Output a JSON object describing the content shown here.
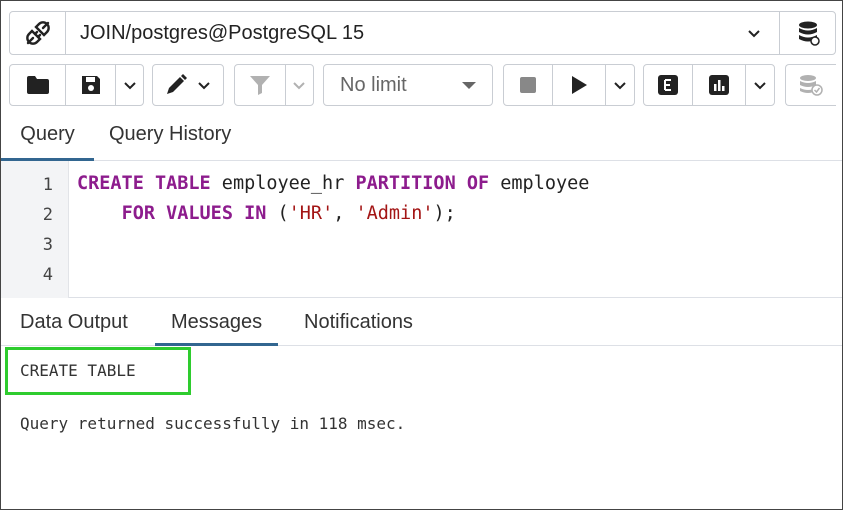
{
  "connection": {
    "title": "JOIN/postgres@PostgreSQL 15"
  },
  "toolbar": {
    "limit_label": "No limit"
  },
  "query_tabs": [
    {
      "label": "Query",
      "active": true
    },
    {
      "label": "Query History",
      "active": false
    }
  ],
  "editor": {
    "line_numbers": [
      "1",
      "2",
      "3",
      "4"
    ],
    "lines": [
      {
        "tokens": [
          {
            "text": "CREATE",
            "type": "keyword"
          },
          {
            "text": " ",
            "type": "plain"
          },
          {
            "text": "TABLE",
            "type": "keyword"
          },
          {
            "text": " employee_hr ",
            "type": "plain"
          },
          {
            "text": "PARTITION",
            "type": "keyword"
          },
          {
            "text": " ",
            "type": "plain"
          },
          {
            "text": "OF",
            "type": "keyword"
          },
          {
            "text": " employee",
            "type": "plain"
          }
        ]
      },
      {
        "tokens": [
          {
            "text": "    ",
            "type": "plain"
          },
          {
            "text": "FOR",
            "type": "keyword"
          },
          {
            "text": " ",
            "type": "plain"
          },
          {
            "text": "VALUES",
            "type": "keyword"
          },
          {
            "text": " ",
            "type": "plain"
          },
          {
            "text": "IN",
            "type": "keyword"
          },
          {
            "text": " (",
            "type": "plain"
          },
          {
            "text": "'HR'",
            "type": "string"
          },
          {
            "text": ", ",
            "type": "plain"
          },
          {
            "text": "'Admin'",
            "type": "string"
          },
          {
            "text": ");",
            "type": "plain"
          }
        ]
      },
      {
        "tokens": []
      },
      {
        "tokens": []
      }
    ]
  },
  "result_tabs": [
    {
      "label": "Data Output",
      "active": false
    },
    {
      "label": "Messages",
      "active": true
    },
    {
      "label": "Notifications",
      "active": false
    }
  ],
  "messages": {
    "command": "CREATE TABLE",
    "status": "Query returned successfully in 118 msec."
  },
  "colors": {
    "keyword": "#8d1c8d",
    "string": "#a31515",
    "active_tab": "#326690",
    "highlight": "#2ecc2e"
  },
  "icons": {
    "connection": "plug-disconnect-icon",
    "database": "database-icon",
    "open": "folder-icon",
    "save": "save-icon",
    "edit": "pencil-icon",
    "filter": "filter-icon",
    "stop": "stop-icon",
    "execute": "play-icon",
    "explain": "explain-icon",
    "explain_analyze": "chart-icon",
    "commit": "commit-icon"
  }
}
